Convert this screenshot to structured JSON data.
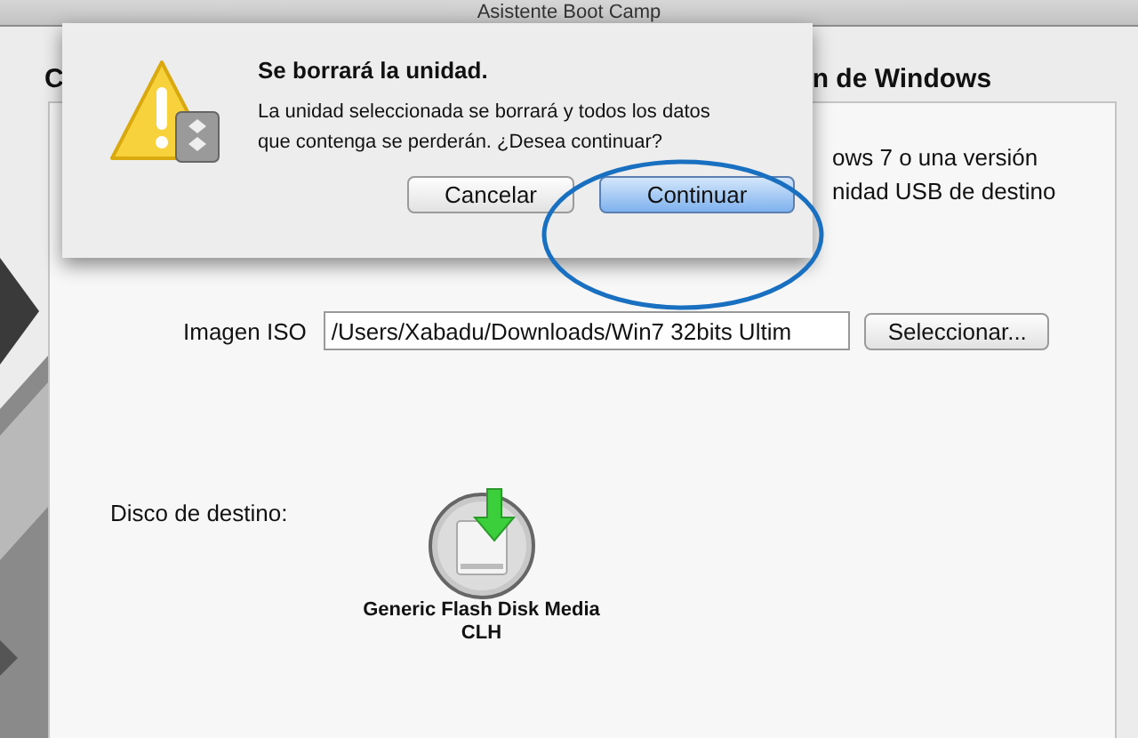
{
  "window": {
    "title": "Asistente Boot Camp"
  },
  "heading_fragments": [
    "C",
    "n de Windows"
  ],
  "intro_fragments": [
    "ows 7 o una versión",
    "nidad USB de destino"
  ],
  "iso": {
    "label": "Imagen ISO",
    "value": "/Users/Xabadu/Downloads/Win7 32bits Ultim",
    "button": "Seleccionar..."
  },
  "destination": {
    "label": "Disco de destino:",
    "disk_lines": [
      "Generic Flash Disk Media",
      "CLH"
    ]
  },
  "sheet": {
    "title": "Se borrará la unidad.",
    "message_lines": [
      "La unidad seleccionada se borrará y todos los datos",
      "que contenga se perderán. ¿Desea continuar?"
    ],
    "buttons": [
      {
        "label": "Cancelar",
        "default": false
      },
      {
        "label": "Continuar",
        "default": true
      }
    ]
  }
}
